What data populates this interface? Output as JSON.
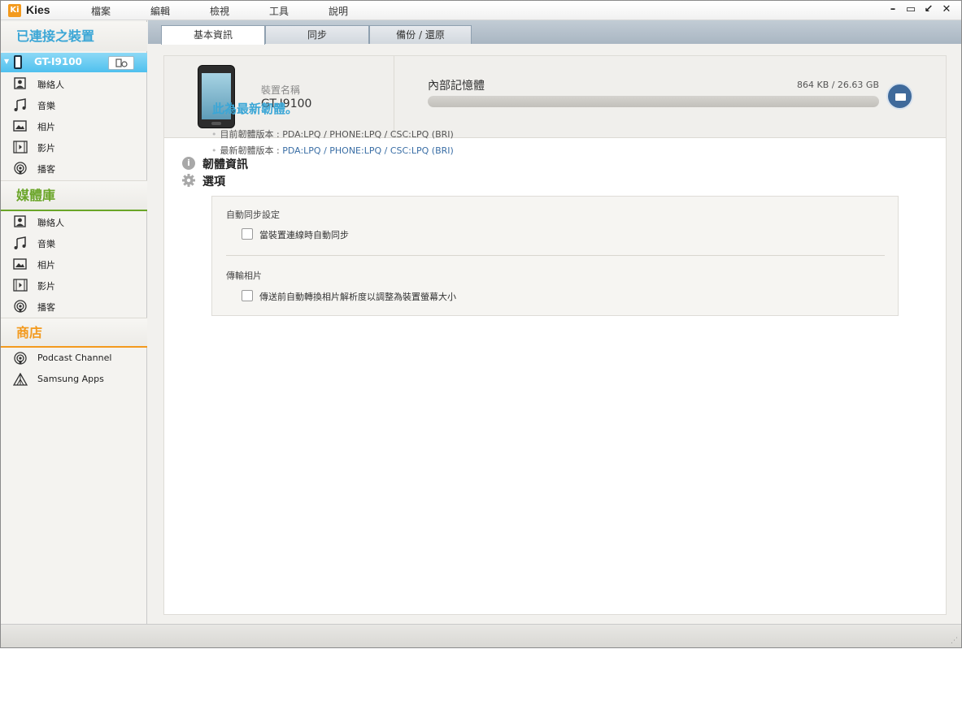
{
  "app": {
    "logo": "Ki",
    "name": "Kies"
  },
  "menu": [
    "檔案",
    "編輯",
    "檢視",
    "工具",
    "說明"
  ],
  "window_controls": [
    "–",
    "▭",
    "↙",
    "✕"
  ],
  "sidebar": {
    "connected_header": "已連接之裝置",
    "device": {
      "name": "GT-I9100"
    },
    "device_items": [
      {
        "label": "聯絡人",
        "icon": "contact-icon"
      },
      {
        "label": "音樂",
        "icon": "music-icon"
      },
      {
        "label": "相片",
        "icon": "photo-icon"
      },
      {
        "label": "影片",
        "icon": "video-icon"
      },
      {
        "label": "播客",
        "icon": "podcast-icon"
      }
    ],
    "library_header": "媒體庫",
    "library_items": [
      {
        "label": "聯絡人",
        "icon": "contact-icon"
      },
      {
        "label": "音樂",
        "icon": "music-icon"
      },
      {
        "label": "相片",
        "icon": "photo-icon"
      },
      {
        "label": "影片",
        "icon": "video-icon"
      },
      {
        "label": "播客",
        "icon": "podcast-icon"
      }
    ],
    "store_header": "商店",
    "store_items": [
      {
        "label": "Podcast Channel",
        "icon": "podcast-icon"
      },
      {
        "label": "Samsung Apps",
        "icon": "apps-icon"
      }
    ],
    "colors": {
      "connected": "#3aa6d6",
      "library": "#6aa528",
      "store": "#f39a1e"
    }
  },
  "tabs": [
    {
      "label": "基本資訊",
      "active": true
    },
    {
      "label": "同步",
      "active": false
    },
    {
      "label": "備份 / 還原",
      "active": false
    }
  ],
  "device_card": {
    "name_label": "裝置名稱",
    "name_value": "GT-I9100",
    "memory_label": "內部記憶體",
    "memory_value": "864 KB / 26.63 GB",
    "memory_used_fraction": 0.0
  },
  "firmware": {
    "title": "韌體資訊",
    "latest_message": "此為最新韌體。",
    "current_label": "目前韌體版本 : ",
    "current_value": "PDA:LPQ / PHONE:LPQ / CSC:LPQ (BRI)",
    "latest_label": "最新韌體版本 : ",
    "latest_value": "PDA:LPQ / PHONE:LPQ / CSC:LPQ (BRI)"
  },
  "options": {
    "title": "選項",
    "auto_sync_header": "自動同步設定",
    "auto_sync_label": "當裝置連線時自動同步",
    "transfer_header": "傳輸相片",
    "transfer_label": "傳送前自動轉換相片解析度以調整為裝置螢幕大小"
  }
}
